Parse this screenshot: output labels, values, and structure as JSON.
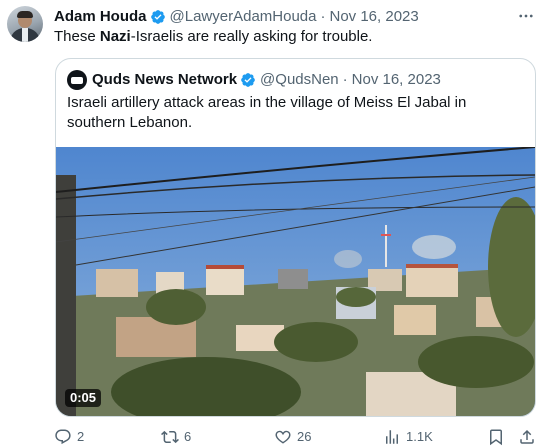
{
  "tweet": {
    "author_name": "Adam Houda",
    "handle": "@LawyerAdamHouda",
    "separator": "·",
    "date": "Nov 16, 2023",
    "text_before": "These ",
    "text_bold": "Nazi",
    "text_after": "-Israelis are really asking for trouble."
  },
  "quoted": {
    "author_name": "Quds News Network",
    "handle": "@QudsNen",
    "separator": "·",
    "date": "Nov 16, 2023",
    "text": "Israeli artillery attack areas in the village of Meiss El Jabal in southern Lebanon.",
    "video_time": "0:05"
  },
  "actions": {
    "replies": "2",
    "reposts": "6",
    "likes": "26",
    "views": "1.1K"
  },
  "colors": {
    "verified": "#1d9bf0",
    "secondary_text": "#536471",
    "border": "#cfd9de"
  },
  "icons": [
    "more-icon",
    "verified-icon",
    "reply-icon",
    "repost-icon",
    "like-icon",
    "views-icon",
    "bookmark-icon",
    "share-icon"
  ]
}
